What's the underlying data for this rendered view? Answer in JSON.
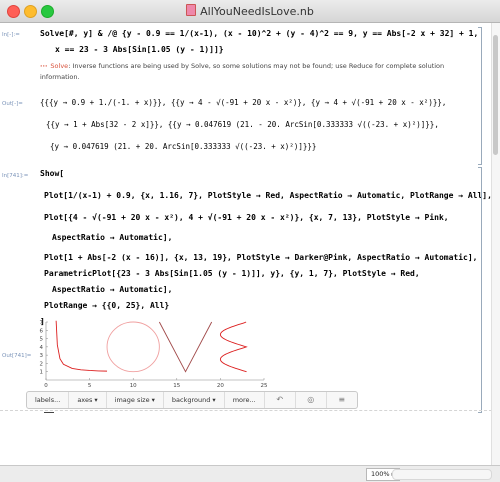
{
  "window": {
    "title": "AllYouNeedIsLove.nb"
  },
  "cells": {
    "in1_label": "In[-]:=",
    "in1_line1": "Solve[#, y] & /@ {y - 0.9 == 1/(x-1), (x - 10)^2 + (y - 4)^2 == 9, y == Abs[-2 x + 32] + 1,",
    "in1_line2": "x == 23 - 3 Abs[Sin[1.05 (y - 1)]]}",
    "msg_tag": "Solve",
    "msg_text": ": Inverse functions are being used by Solve, so some solutions may not be found; use Reduce for complete solution information.",
    "out1_label": "Out[-]=",
    "out1_line1": "{{{y → 0.9 + 1./(-1. + x)}}, {{y → 4 - √(-91 + 20 x - x²)}, {y → 4 + √(-91 + 20 x - x²)}},",
    "out1_line2": "{{y → 1 + Abs[32 - 2 x]}}, {{y → 0.047619 (21. - 20. ArcSin[0.333333 √((-23. + x)²)]}},",
    "out1_line3": "{y → 0.047619 (21. + 20. ArcSin[0.333333 √((-23. + x)²)]}}}",
    "in2_label": "In[741]:=",
    "in2_line1": "Show[",
    "in2_line2": "Plot[1/(x-1) + 0.9, {x, 1.16, 7}, PlotStyle → Red, AspectRatio → Automatic, PlotRange → All],",
    "in2_line3": "Plot[{4 - √(-91 + 20 x - x²), 4 + √(-91 + 20 x - x²)}, {x, 7, 13}, PlotStyle → Pink,",
    "in2_line4": "AspectRatio → Automatic],",
    "in2_line5": "Plot[1 + Abs[-2 (x - 16)], {x, 13, 19}, PlotStyle → Darker@Pink, AspectRatio → Automatic],",
    "in2_line6": "ParametricPlot[{23 - 3 Abs[Sin[1.05 (y - 1)]], y}, {y, 1, 7}, PlotStyle → Red,",
    "in2_line7": "AspectRatio → Automatic],",
    "in2_line8": "PlotRange → {{0, 25}, All}",
    "in2_line9": "]",
    "out2_label": "Out[741]="
  },
  "chart_data": {
    "type": "line",
    "xlim": [
      0,
      25
    ],
    "ylim": [
      0,
      7
    ],
    "xticks": [
      "0",
      "5",
      "10",
      "15",
      "20",
      "25"
    ],
    "yticks": [
      "1",
      "2",
      "3",
      "4",
      "5",
      "6",
      "7"
    ],
    "series": [
      {
        "color": "#dc1e1e",
        "points": [
          [
            1.16,
            7.15
          ],
          [
            1.3,
            4.23
          ],
          [
            1.6,
            2.57
          ],
          [
            2,
            1.9
          ],
          [
            3,
            1.4
          ],
          [
            4,
            1.23
          ],
          [
            5,
            1.15
          ],
          [
            6,
            1.1
          ],
          [
            7,
            1.07
          ]
        ]
      },
      {
        "color": "#f0a0a0",
        "circle": {
          "cx": 10,
          "cy": 4,
          "r": 3
        }
      },
      {
        "color": "#a04848",
        "points": [
          [
            13,
            7
          ],
          [
            16,
            1
          ],
          [
            19,
            7
          ]
        ]
      },
      {
        "color": "#dc1e1e",
        "param": "23 - 3 Abs[Sin[1.05 (y - 1)]]",
        "yrange": [
          1,
          7
        ]
      }
    ]
  },
  "toolbar": {
    "labels": "labels...",
    "axes": "axes ▾",
    "image_size": "image size ▾",
    "background": "background ▾",
    "more": "more...",
    "colors": {
      "icon": "#777777"
    }
  },
  "status": {
    "zoom": "100% ▸"
  }
}
